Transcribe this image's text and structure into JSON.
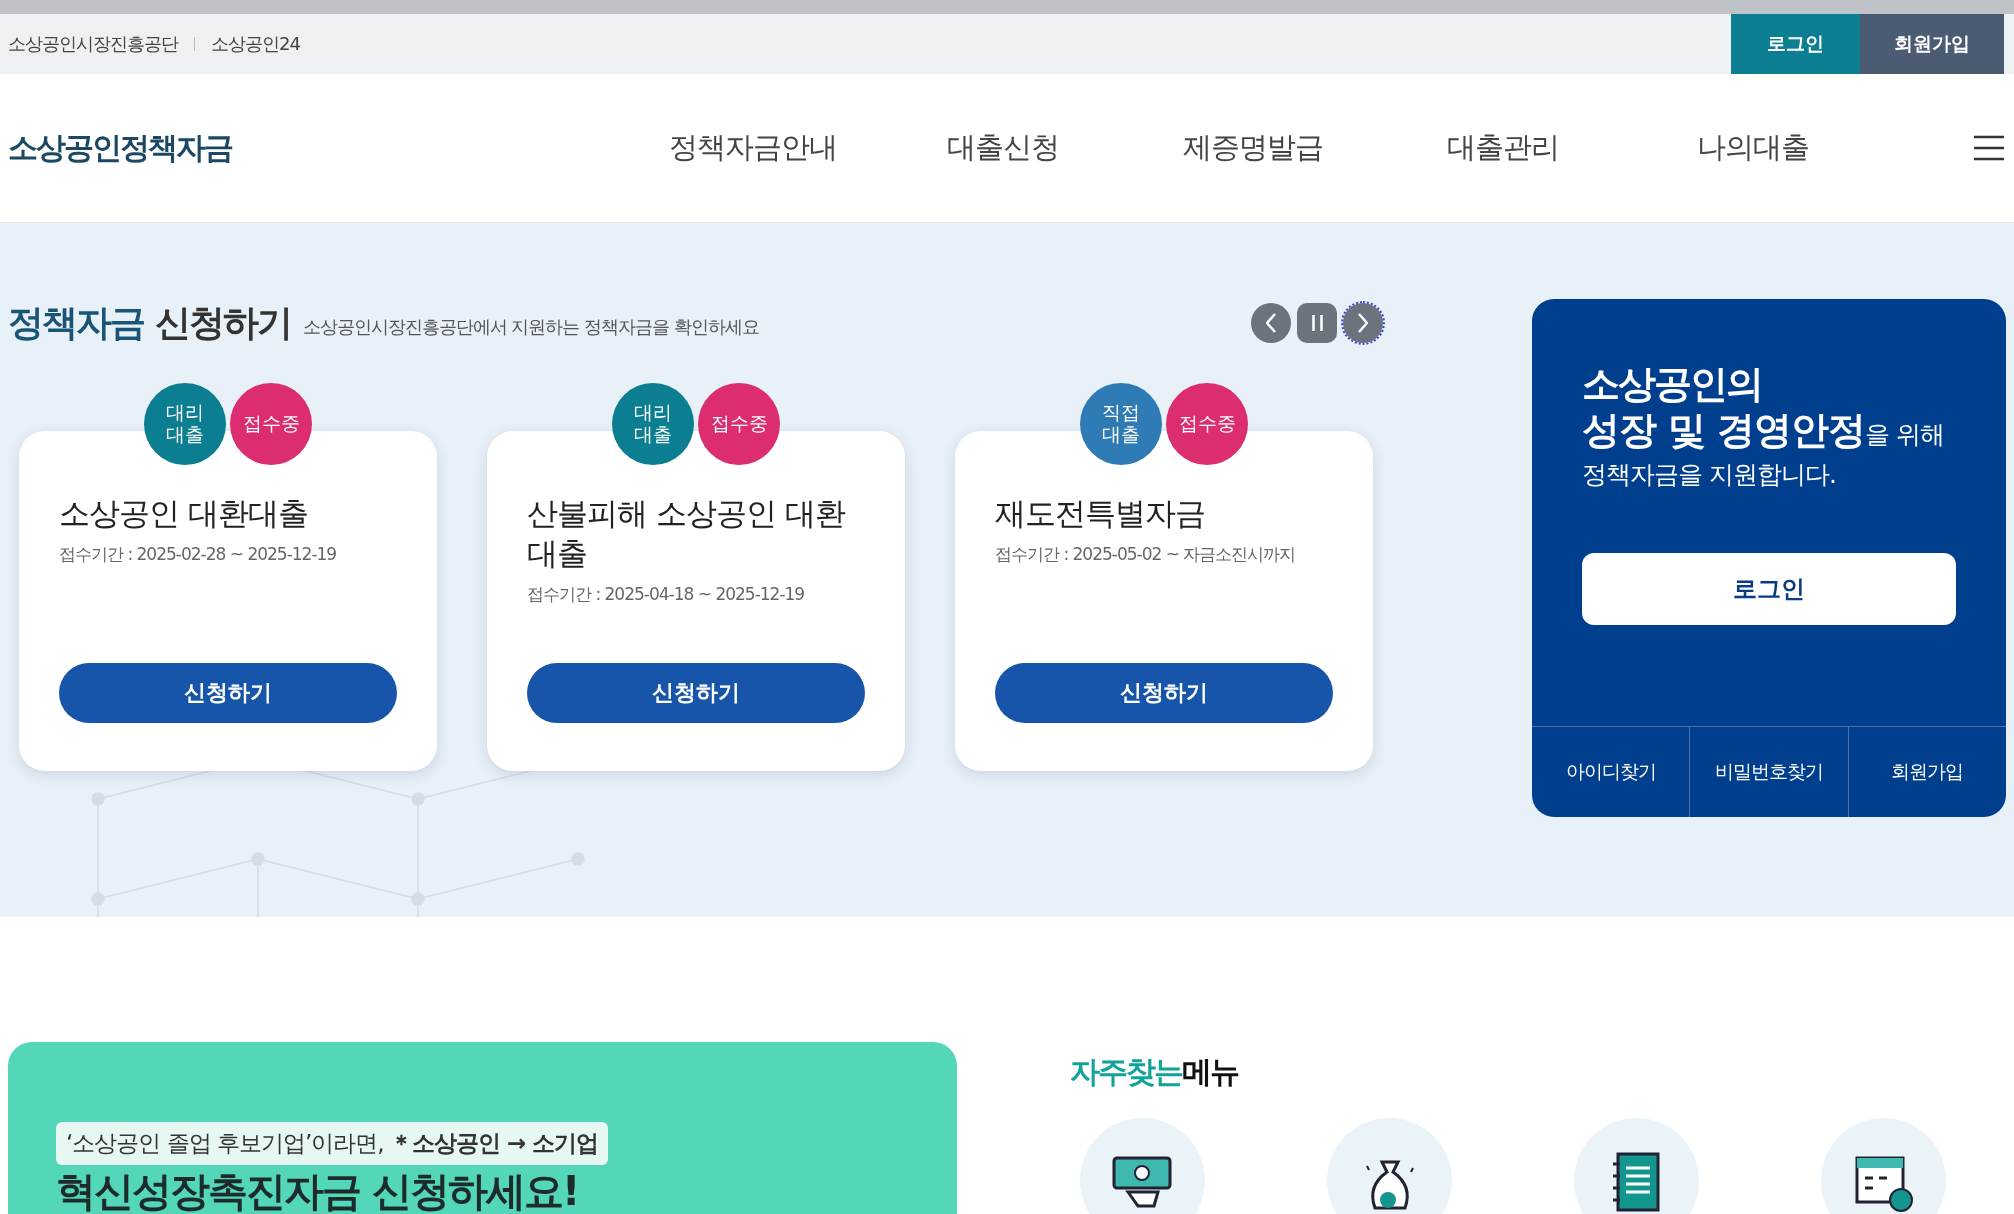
{
  "top_bar": {
    "links": [
      "소상공인시장진흥공단",
      "소상공인24"
    ],
    "buttons": [
      {
        "label": "로그인",
        "kind": "login"
      },
      {
        "label": "회원가입",
        "kind": "signup"
      }
    ]
  },
  "header": {
    "logo": "소상공인정책자금",
    "nav": [
      "정책자금안내",
      "대출신청",
      "제증명발급",
      "대출관리",
      "나의대출"
    ]
  },
  "section": {
    "title_accent": "정책자금",
    "title_rest": "신청하기",
    "subtitle": "소상공인시장진흥공단에서 지원하는 정책자금을 확인하세요"
  },
  "cards": [
    {
      "badges": [
        {
          "label": "대리\n대출",
          "color": "#0b7f91"
        },
        {
          "label": "접수중",
          "color": "#db2d6f"
        }
      ],
      "title": "소상공인 대환대출",
      "period": "접수기간 : 2025-02-28 ~ 2025-12-19",
      "button": "신청하기"
    },
    {
      "badges": [
        {
          "label": "대리\n대출",
          "color": "#0b7f91"
        },
        {
          "label": "접수중",
          "color": "#db2d6f"
        }
      ],
      "title": "산불피해 소상공인 대환대출",
      "period": "접수기간 : 2025-04-18 ~ 2025-12-19",
      "button": "신청하기"
    },
    {
      "badges": [
        {
          "label": "직접\n대출",
          "color": "#2f7bb5"
        },
        {
          "label": "접수중",
          "color": "#db2d6f"
        }
      ],
      "title": "재도전특별자금",
      "period": "접수기간 : 2025-05-02 ~ 자금소진시까지",
      "button": "신청하기"
    }
  ],
  "login_panel": {
    "headline": "소상공인의",
    "message": "**성장 및 경영안정**을 위해",
    "message_2": "정책자금을 지원합니다.",
    "button": "로그인",
    "links": [
      "아이디찾기",
      "비밀번호찾기",
      "회원가입"
    ]
  },
  "banner": {
    "tag": "‘소상공인 졸업 후보기업’이라면, **＊소상공인 → 소기업**",
    "headline": "혁신성장촉진자금 신청하세요!"
  },
  "quick_menu": {
    "title_accent": "자주찾는",
    "title_rest": "메뉴",
    "items": [
      {
        "kind": "money"
      },
      {
        "kind": "bag"
      },
      {
        "kind": "document"
      },
      {
        "kind": "calendar"
      }
    ]
  }
}
